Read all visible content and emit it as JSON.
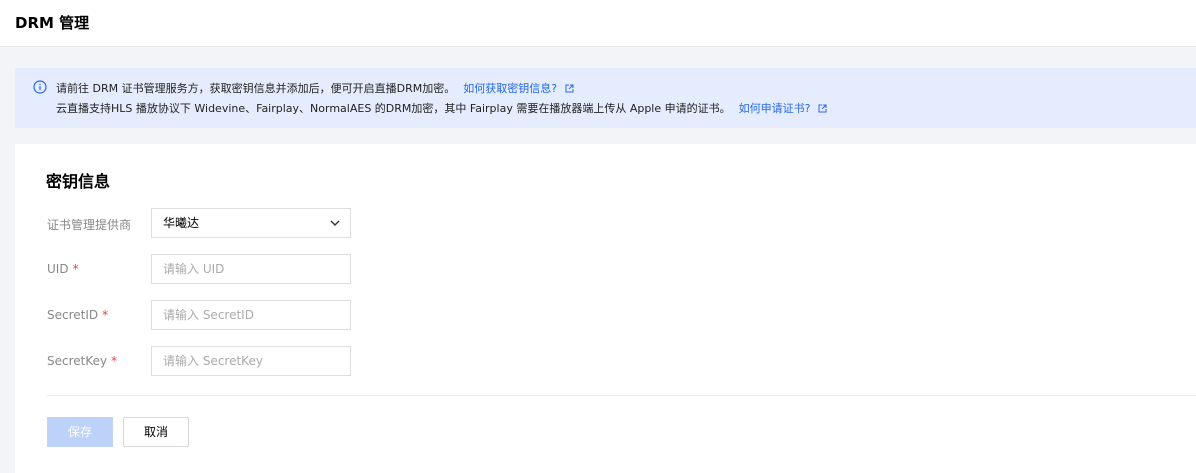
{
  "header": {
    "title": "DRM 管理"
  },
  "notice": {
    "line1_text": "请前往 DRM 证书管理服务方，获取密钥信息并添加后，便可开启直播DRM加密。",
    "line1_link": "如何获取密钥信息?",
    "line2_text": "云直播支持HLS 播放协议下 Widevine、Fairplay、NormalAES 的DRM加密，其中 Fairplay 需要在播放器端上传从 Apple 申请的证书。",
    "line2_link": "如何申请证书?",
    "icon": "info-icon",
    "link_icon": "external-link-icon",
    "accent": "#2768e8",
    "background": "#e4ecfd"
  },
  "form": {
    "section_title": "密钥信息",
    "provider": {
      "label": "证书管理提供商",
      "value": "华曦达"
    },
    "uid": {
      "label": "UID",
      "required_mark": "*",
      "placeholder": "请输入 UID"
    },
    "secret_id": {
      "label": "SecretID",
      "required_mark": "*",
      "placeholder": "请输入 SecretID"
    },
    "secret_key": {
      "label": "SecretKey",
      "required_mark": "*",
      "placeholder": "请输入 SecretKey"
    }
  },
  "actions": {
    "save_label": "保存",
    "cancel_label": "取消"
  }
}
